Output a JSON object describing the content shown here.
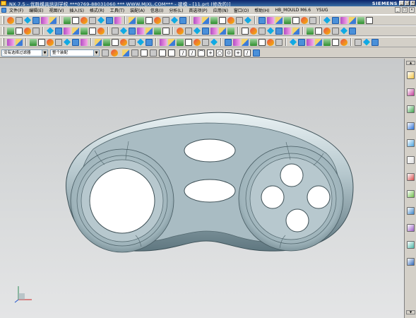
{
  "window": {
    "title": "NX 7.5 - 优胜模具培训学校 ***0769-88031060 *** WWW.MJXL.COM*** - 建模 - [11.prt (修改的)]",
    "brand": "SIEMENS",
    "controls": [
      "_",
      "□",
      "×"
    ]
  },
  "menu": {
    "items": [
      "文件(F)",
      "编辑(E)",
      "视图(V)",
      "插入(S)",
      "格式(R)",
      "工具(T)",
      "装配(A)",
      "信息(I)",
      "分析(L)",
      "首选项(P)",
      "应用(N)",
      "窗口(O)",
      "帮助(H)",
      "HB_MOULD M6.6",
      "YSUG"
    ],
    "window_controls": [
      "_",
      "□",
      "×"
    ]
  },
  "selection_bar": {
    "filter": "没有选择过滤器",
    "scope": "整个装配"
  },
  "icons": {
    "toolbar_row1": [
      "sketch-icon",
      "datum-plane-icon",
      "extrude-icon",
      "revolve-icon",
      "sweep-icon",
      "tube-icon",
      "edge-blend-icon",
      "chamfer-icon",
      "shell-icon",
      "hole-icon",
      "boss-icon",
      "pocket-icon",
      "pad-icon",
      "slot-icon",
      "groove-icon",
      "trim-body-icon",
      "split-body-icon",
      "unite-icon",
      "subtract-icon",
      "intersect-icon",
      "mirror-icon",
      "pattern-icon",
      "offset-face-icon",
      "scale-body-icon",
      "sew-icon",
      "patch-icon",
      "draft-icon",
      "thicken-icon"
    ],
    "selbar_snaps": [
      "endpoint-snap-icon",
      "midpoint-snap-icon",
      "control-point-snap-icon",
      "intersection-snap-icon",
      "arc-center-snap-icon",
      "quadrant-snap-icon",
      "point-on-curve-snap-icon",
      "point-on-face-snap-icon"
    ],
    "resource_bar": [
      "assembly-navigator-icon",
      "part-navigator-icon",
      "reuse-library-icon",
      "hd3d-tools-icon",
      "web-browser-icon",
      "history-icon",
      "system-materials-icon",
      "process-studio-icon",
      "manufacturing-wizard-icon",
      "roles-icon",
      "system-scenes-icon",
      "palette-icon"
    ]
  },
  "colors": {
    "part_face": "#a9bcc3",
    "viewport_top": "#c8cacb",
    "viewport_bottom": "#e4e5e6",
    "titlebar": "#0a246a"
  }
}
